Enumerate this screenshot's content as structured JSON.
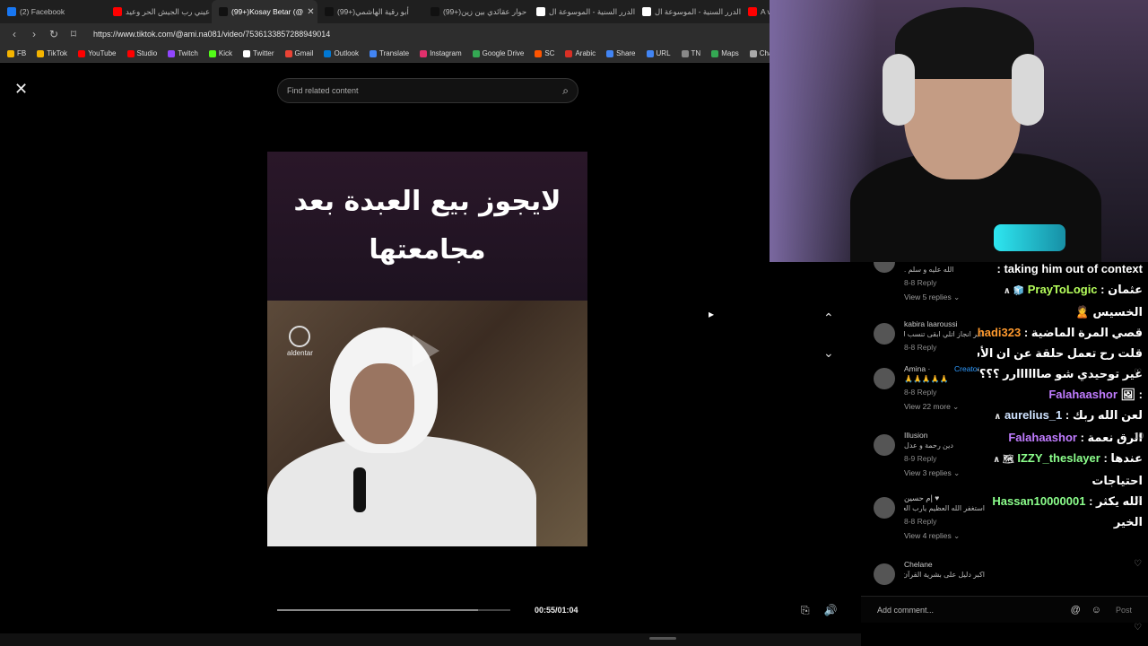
{
  "tabs": [
    {
      "label": "(2) Facebook",
      "color": "#1877f2",
      "active": false
    },
    {
      "label": "عيني رب الجيش الحر وعيد",
      "color": "#ff0000",
      "active": false
    },
    {
      "label": "(99+)Kosay Betar (@",
      "color": "#111111",
      "active": true,
      "close": "✕"
    },
    {
      "label": "(99+)أبو رقية الهاشمي",
      "color": "#111111",
      "active": false
    },
    {
      "label": "(99+)حوار عقائدي بين زين",
      "color": "#111111",
      "active": false
    },
    {
      "label": "الدرر السنية - الموسوعة ال",
      "color": "#ffffff",
      "active": false
    },
    {
      "label": "الدرر السنية - الموسوعة ال",
      "color": "#ffffff",
      "active": false
    },
    {
      "label": "A vie",
      "color": "#ff0000",
      "active": false
    }
  ],
  "urlbar": {
    "url": "https://www.tiktok.com/@ami.na081/video/7536133857288949014",
    "back": "‹",
    "forward": "›",
    "reload": "↻",
    "bookmark": "⌑"
  },
  "bookmarks": [
    {
      "label": "FB",
      "color": "#f4b400"
    },
    {
      "label": "TikTok",
      "color": "#f4b400"
    },
    {
      "label": "YouTube",
      "color": "#ff0000"
    },
    {
      "label": "Studio",
      "color": "#ff0000"
    },
    {
      "label": "Twitch",
      "color": "#9146ff"
    },
    {
      "label": "Kick",
      "color": "#53fc18"
    },
    {
      "label": "Twitter",
      "color": "#ffffff"
    },
    {
      "label": "Gmail",
      "color": "#ea4335"
    },
    {
      "label": "Outlook",
      "color": "#0078d4"
    },
    {
      "label": "Translate",
      "color": "#4285f4"
    },
    {
      "label": "Instagram",
      "color": "#e1306c"
    },
    {
      "label": "Google Drive",
      "color": "#34a853"
    },
    {
      "label": "SC",
      "color": "#ff5500"
    },
    {
      "label": "Arabic",
      "color": "#d93025"
    },
    {
      "label": "Share",
      "color": "#4285f4"
    },
    {
      "label": "URL",
      "color": "#4285f4"
    },
    {
      "label": "TN",
      "color": "#888888"
    },
    {
      "label": "Maps",
      "color": "#34a853"
    },
    {
      "label": "Chat",
      "color": "#aaaaaa"
    }
  ],
  "page": {
    "close": "✕",
    "search_placeholder": "Find related content",
    "search_icon": "⌕",
    "video_title_line1": "لايجوز بيع العبدة بعد",
    "video_title_line2": "مجامعتها",
    "watermark": "aldentar",
    "timecode": "00:55/01:04",
    "progress_fraction": 0.86,
    "arrow_up": "⌃",
    "arrow_down": "⌄",
    "caption_icon": "⎘",
    "volume_icon": "🔊"
  },
  "comments": [
    {
      "name": "",
      "text": "الله عليه و سلم .",
      "meta": "8-8   Reply",
      "replies": "View 5 replies ⌄"
    },
    {
      "name": "kabira laaroussi",
      "text": "اكبر انجاز اتلي ابقى تنسب لديني هو تركي لها الدين 👍",
      "meta": "8-8   Reply",
      "replies": ""
    },
    {
      "name": "Amina · ",
      "creator": "Creator",
      "text": "🙏🙏🙏🙏🙏",
      "meta": "8-8   Reply",
      "replies": "View 22 more ⌄"
    },
    {
      "name": "Illusion",
      "text": "دين رحمة و عدل",
      "meta": "8-9   Reply",
      "replies": "View 3 replies ⌄"
    },
    {
      "name": "إم حسين ♥",
      "text": "استغفر الله العظيم يارب العالمين",
      "meta": "8-8   Reply",
      "replies": "View 4 replies ⌄"
    },
    {
      "name": "Chelane",
      "text": "اكبر دليل على بشرية القرآن",
      "meta": "",
      "replies": ""
    }
  ],
  "add_comment": {
    "placeholder": "Add comment...",
    "at": "@",
    "emoji": "☺",
    "post": "Post"
  },
  "chat": [
    {
      "user": "",
      "text": "taking him out of context :"
    },
    {
      "user": "PrayToLogic",
      "badge": "🧊 ∧",
      "text": "عثمان :",
      "cls": "u1"
    },
    {
      "user": "",
      "text": "الخسيس 🙎"
    },
    {
      "user": "alhadi323",
      "text": "قصي المرة الماضية :",
      "cls": "u2"
    },
    {
      "user": "",
      "text": "قلت رح تعمل حلقة عن ان الأسلام دين"
    },
    {
      "user": "",
      "text": "غير توحيدي شو صاااااارر ؟؟؟؟"
    },
    {
      "user": "Falahaashor",
      "text": ": 🖼",
      "cls": "u3"
    },
    {
      "user": "aurelius_1",
      "badge": "∧",
      "text": "لعن الله ربك :",
      "cls": "u4"
    },
    {
      "user": "Falahaashor",
      "text": "الرق نعمة :",
      "cls": "u5"
    },
    {
      "user": "IZZY_theslayer",
      "badge": "🗺 ∧",
      "text": "عندها :",
      "cls": "u6"
    },
    {
      "user": "",
      "text": "احتياجات"
    },
    {
      "user": "Hassan10000001",
      "text": "الله يكثر :",
      "cls": "u7"
    },
    {
      "user": "",
      "text": "الخير"
    }
  ],
  "heart_counts": [
    "♡",
    "10",
    "♡",
    "♡",
    "♡"
  ]
}
